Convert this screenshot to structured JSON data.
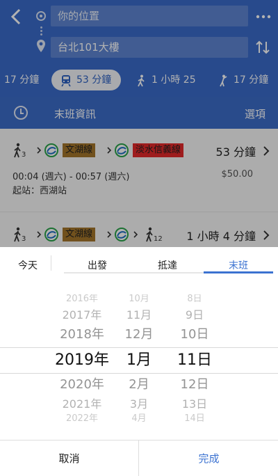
{
  "header": {
    "origin": "你的位置",
    "destination": "台北101大樓",
    "colors": {
      "primary": "#3a6bc9",
      "accent": "#3b72d1"
    }
  },
  "modes": [
    {
      "icon": "car-icon",
      "label": "17 分鐘"
    },
    {
      "icon": "transit-icon",
      "label": "53 分鐘",
      "selected": true
    },
    {
      "icon": "walk-icon",
      "label": "1 小時 25"
    },
    {
      "icon": "ride-icon",
      "label": "17 分鐘"
    }
  ],
  "options_bar": {
    "title": "末班資訊",
    "options": "選項"
  },
  "routes": [
    {
      "walk1_min": "3",
      "line1": "文湖線",
      "line2": "淡水信義線",
      "duration": "53 分鐘",
      "times": "00:04 (週六) - 00:57 (週六)",
      "fare": "$50.00",
      "start": "起站：西湖站"
    },
    {
      "walk1_min": "3",
      "line1": "文湖線",
      "walk2_min": "12",
      "duration": "1 小時 4 分鐘"
    }
  ],
  "sheet": {
    "today": "今天",
    "tabs": [
      "出發",
      "抵達",
      "末班"
    ],
    "selected_tab": "末班",
    "picker": {
      "years": [
        "2016年",
        "2017年",
        "2018年",
        "2019年",
        "2020年",
        "2021年",
        "2022年"
      ],
      "months": [
        "10月",
        "11月",
        "12月",
        "1月",
        "2月",
        "3月",
        "4月"
      ],
      "days": [
        "8日",
        "9日",
        "10日",
        "11日",
        "12日",
        "13日",
        "14日"
      ],
      "selected": {
        "year": "2019年",
        "month": "1月",
        "day": "11日"
      }
    },
    "cancel": "取消",
    "done": "完成"
  }
}
